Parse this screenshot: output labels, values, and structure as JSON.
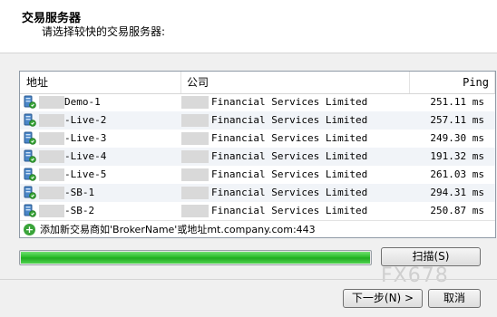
{
  "dialog": {
    "title": "交易服务器",
    "subtitle": "请选择较快的交易服务器:"
  },
  "table": {
    "columns": {
      "address": "地址",
      "company": "公司",
      "ping": "Ping"
    },
    "rows": [
      {
        "address": "Demo-1",
        "company": "Financial Services Limited",
        "ping": "251.11 ms"
      },
      {
        "address": "-Live-2",
        "company": "Financial Services Limited",
        "ping": "257.11 ms"
      },
      {
        "address": "-Live-3",
        "company": "Financial Services Limited",
        "ping": "249.30 ms"
      },
      {
        "address": "-Live-4",
        "company": "Financial Services Limited",
        "ping": "191.32 ms"
      },
      {
        "address": "-Live-5",
        "company": "Financial Services Limited",
        "ping": "261.03 ms"
      },
      {
        "address": "-SB-1",
        "company": "Financial Services Limited",
        "ping": "294.31 ms"
      },
      {
        "address": "-SB-2",
        "company": "Financial Services Limited",
        "ping": "250.87 ms"
      }
    ],
    "add_row_text": "添加新交易商如'BrokerName'或地址mt.company.com:443"
  },
  "progress": {
    "value": 1.0,
    "color": "#22b822"
  },
  "buttons": {
    "scan": "扫描(S)",
    "next": "下一步(N) >",
    "cancel": "取消"
  },
  "watermark": "FX678",
  "icons": {
    "server": "server-icon",
    "add": "plus-circle-icon"
  }
}
